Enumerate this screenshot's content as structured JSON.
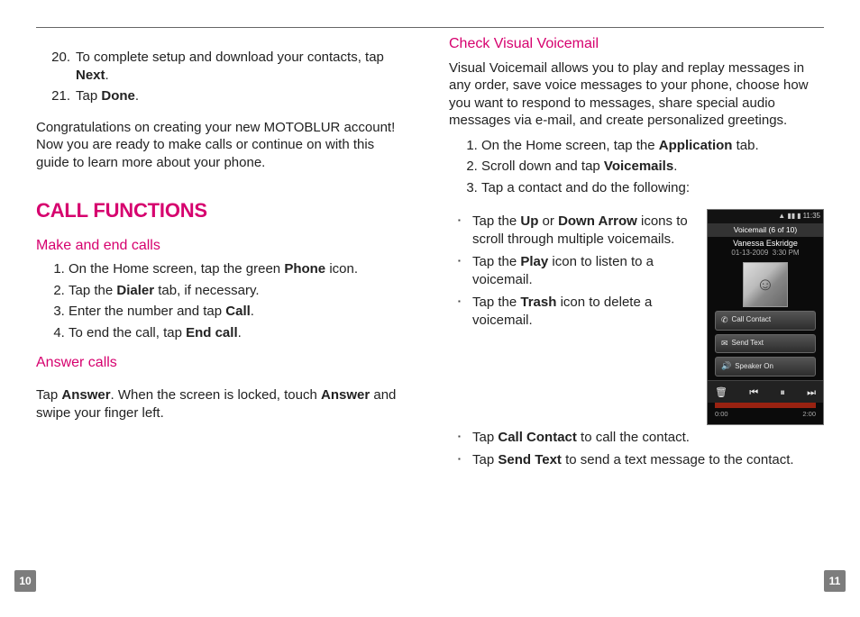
{
  "leftColumn": {
    "setupSteps": [
      {
        "num": "20.",
        "text": "To complete setup and download your contacts, tap ",
        "bold": "Next",
        "after": "."
      },
      {
        "num": "21.",
        "text": "Tap ",
        "bold": "Done",
        "after": "."
      }
    ],
    "congrats": "Congratulations on creating your new MOTOBLUR account! Now you are ready to make calls or continue on with this guide to learn more about your phone.",
    "sectionTitle": "CALL FUNCTIONS",
    "makeEndTitle": "Make and end calls",
    "makeEndSteps": [
      {
        "pre": "On the Home screen, tap the green ",
        "bold": "Phone",
        "post": " icon."
      },
      {
        "pre": "Tap the ",
        "bold": "Dialer",
        "post": " tab, if necessary."
      },
      {
        "pre": "Enter the number and tap ",
        "bold": "Call",
        "post": "."
      },
      {
        "pre": "To end the call, tap ",
        "bold": "End call",
        "post": "."
      }
    ],
    "answerTitle": "Answer calls",
    "answerText": {
      "t1": "Tap ",
      "b1": "Answer",
      "t2": ". When the screen is locked, touch ",
      "b2": "Answer",
      "t3": " and swipe your finger left."
    }
  },
  "rightColumn": {
    "vvTitle": "Check Visual Voicemail",
    "vvIntro": "Visual Voicemail allows you to play and replay messages in any order, save voice messages to your phone, choose how you want to respond to messages, share special audio messages via e-mail, and create personalized greetings.",
    "vvSteps": [
      {
        "pre": "On the Home screen, tap the ",
        "bold": "Application",
        "post": " tab."
      },
      {
        "pre": "Scroll down and tap ",
        "bold": "Voicemails",
        "post": "."
      },
      {
        "pre": "Tap a contact and do the following:",
        "bold": "",
        "post": ""
      }
    ],
    "bulletsTop": [
      {
        "t1": "Tap the ",
        "b1": "Up",
        "t2": " or ",
        "b2": "Down Arrow",
        "t3": " icons to scroll through multiple voicemails."
      },
      {
        "t1": "Tap the ",
        "b1": "Play",
        "t2": " icon to listen to a voicemail.",
        "b2": "",
        "t3": ""
      },
      {
        "t1": "Tap the ",
        "b1": "Trash",
        "t2": " icon to delete a voicemail.",
        "b2": "",
        "t3": ""
      }
    ],
    "bulletsBottom": [
      {
        "t1": "Tap ",
        "b1": "Call Contact",
        "t2": " to call the contact.",
        "b2": "",
        "t3": ""
      },
      {
        "t1": "Tap ",
        "b1": "Send Text",
        "t2": " to send a text message to the contact.",
        "b2": "",
        "t3": ""
      }
    ]
  },
  "phone": {
    "statusTime": "11:35",
    "title": "Voicemail (6 of 10)",
    "name": "Vanessa Eskridge",
    "date": "01-13-2009",
    "time": "3:30 PM",
    "buttons": [
      {
        "icon": "✆",
        "label": "Call Contact"
      },
      {
        "icon": "✉",
        "label": "Send Text"
      },
      {
        "icon": "🔊",
        "label": "Speaker On"
      }
    ],
    "controls": {
      "trash": "🗑",
      "prev": "⏮",
      "play": "⏸",
      "next": "⏭"
    },
    "elapsed": "0:00",
    "total": "2:00"
  },
  "pages": {
    "left": "10",
    "right": "11"
  }
}
